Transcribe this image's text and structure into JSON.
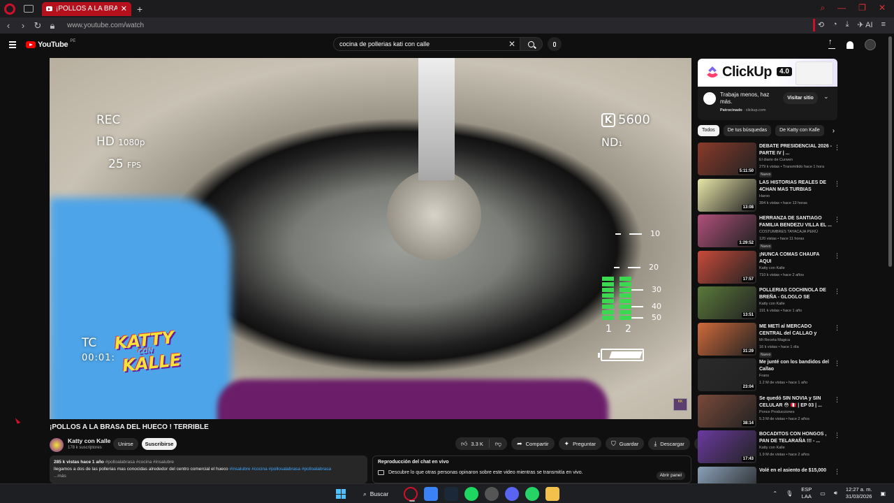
{
  "browser": {
    "tab_title": "¡POLLOS A LA BRASA DEL",
    "url": "www.youtube.com/watch",
    "ai_label": "AI"
  },
  "header": {
    "logo_text": "YouTube",
    "country": "PE",
    "search_value": "cocina de pollerias kati con calle"
  },
  "video": {
    "overlay": {
      "rec": "REC",
      "hd": "HD",
      "res": "1080p",
      "fps_value": "25",
      "fps_label": "FPS",
      "kelvin": "5600",
      "k_label": "K",
      "nd": "ND",
      "nd_sub": "1",
      "tc": "TC",
      "timecode": "00:01:",
      "vu_marks": [
        "10",
        "20",
        "30",
        "40",
        "50"
      ],
      "channel_1": "1",
      "channel_2": "2",
      "logo_line1": "KATTY",
      "logo_line2": "CON",
      "logo_line3": "KALLE",
      "vu_level_ch1": 0.85,
      "vu_level_ch2": 0.85
    },
    "title": "¡POLLOS A LA BRASA DEL HUECO ! TERRIBLE",
    "channel_name": "Katty con Kalle",
    "subscribers": "178 k suscriptores",
    "join_label": "Unirse",
    "subscribe_label": "Suscribirse",
    "likes": "3.3 K",
    "share_label": "Compartir",
    "ask_label": "Preguntar",
    "save_label": "Guardar",
    "download_label": "Descargar"
  },
  "description": {
    "views_date": "285 k vistas  hace 1 año",
    "tags_top": "#polloalabrasa #cocina #insalubre",
    "text": "llegamos a dos de las pollerias mas conocidas alrededor del centro comercial el hueco",
    "tags_inline": "#insalubre #cocina #pollosalabrasa #polloalabrasa",
    "more": "...más"
  },
  "chat_replay": {
    "title": "Reproducción del chat en vivo",
    "text": "Descubre lo que otras personas opinaron sobre este video mientras se transmitía en vivo.",
    "open_label": "Abrir panel"
  },
  "ad": {
    "brand": "ClickUp",
    "version": "4.0",
    "text": "Trabaja menos, haz más.",
    "sponsored": "Patrocinado",
    "domain": "clickup.com",
    "visit_label": "Visitar sitio"
  },
  "chips": [
    "Todos",
    "De tus búsquedas",
    "De Katty con Kalle"
  ],
  "recommendations": [
    {
      "title": "DEBATE PRESIDENCIAL 2026 - PARTE IV | ...",
      "channel": "El diario de Curwen",
      "meta": "279 k vistas • Transmitido hace 1 hora",
      "duration": "5:11:50",
      "badge": "Nuevo",
      "color": "#8a3a2a"
    },
    {
      "title": "LAS HISTORIAS REALES DE 4CHAN MAS TURBIAS",
      "channel": "Haroo",
      "meta": "394 k vistas • hace 13 horas",
      "duration": "13:08",
      "badge": "",
      "color": "#e8e6a8"
    },
    {
      "title": "HERRANZA DE SANTIAGO FAMILIA BENDEZU VILLA EL ...",
      "channel": "COSTUMBRES TAYACAJA PERÚ",
      "meta": "120 vistas • hace 11 horas",
      "duration": "1:29:52",
      "badge": "Nuevo",
      "color": "#b0507a"
    },
    {
      "title": "¡NUNCA COMAS CHAUFA AQUI",
      "channel": "Katty con Kalle",
      "meta": "710 k vistas • hace 2 años",
      "duration": "17:57",
      "badge": "",
      "color": "#c94a3a"
    },
    {
      "title": "POLLERIAS COCHINOLA DE BREÑA - GLOGLO SE INFILTRA...",
      "channel": "Katty con Kalle",
      "meta": "191 k vistas • hace 1 año",
      "duration": "13:51",
      "badge": "",
      "color": "#5a7a3a"
    },
    {
      "title": "ME METÍ al MERCADO CENTRAL del CALLAO y termi...",
      "channel": "Mi Receta Magica",
      "meta": "16 k vistas • hace 1 día",
      "duration": "31:29",
      "badge": "Nuevo",
      "color": "#d06a3a"
    },
    {
      "title": "Me junté con los bandidos del Callao",
      "channel": "Frans",
      "meta": "1.2 M de vistas • hace 1 año",
      "duration": "23:04",
      "badge": "",
      "color": "#2a2a2a"
    },
    {
      "title": "Se quedó SIN NOVIA y SIN CELULAR 😳 🇵🇪 | EP 03 | ...",
      "channel": "Ponce Producciones",
      "meta": "5.3 M de vistas • hace 2 años",
      "duration": "38:14",
      "badge": "",
      "color": "#7a4a3a"
    },
    {
      "title": "BOCADITOS CON HONGOS , PAN DE TELARAÑA !!! - ...",
      "channel": "Katty con Kalle",
      "meta": "1.9 M de vistas • hace 2 años",
      "duration": "17:43",
      "badge": "",
      "color": "#6a3aa0"
    },
    {
      "title": "Volé en el asiento de $15,000",
      "channel": "",
      "meta": "",
      "duration": "",
      "badge": "",
      "color": "#8aa0b8"
    }
  ],
  "taskbar": {
    "search_label": "Buscar",
    "lang_1": "ESP",
    "lang_2": "LAA",
    "time": "12:27 a. m.",
    "date": "31/03/2026"
  }
}
